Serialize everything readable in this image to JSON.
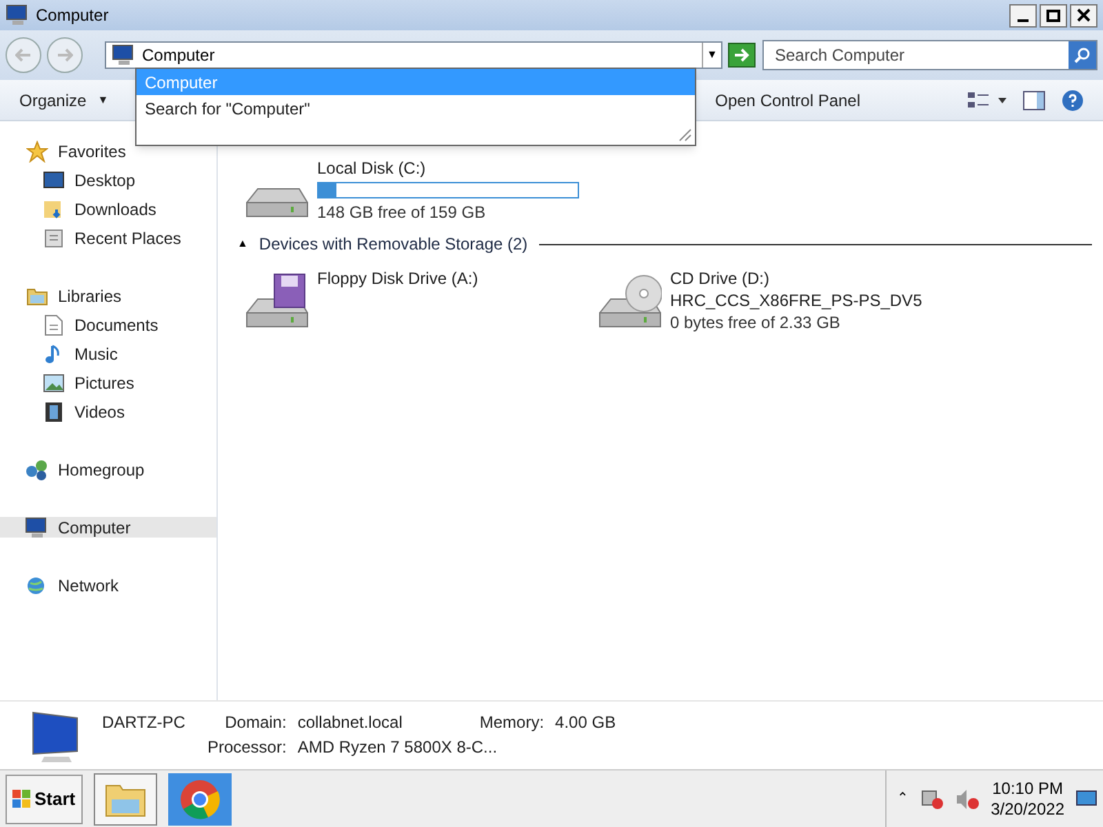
{
  "window": {
    "title": "Computer"
  },
  "address_bar": {
    "value": "Computer",
    "dropdown_arrow": "▼",
    "search_placeholder": "Search Computer"
  },
  "address_dropdown": [
    {
      "label": "Computer",
      "selected": true
    },
    {
      "label": "Search for \"Computer\"",
      "selected": false
    }
  ],
  "toolbar": {
    "left": "Organize",
    "left_caret": "▼",
    "right": "Open Control Panel"
  },
  "sidebar": [
    {
      "label": "Favorites",
      "kind": "star",
      "selected": false,
      "children": [
        {
          "label": "Desktop",
          "kind": "desktop",
          "selected": false
        },
        {
          "label": "Downloads",
          "kind": "downloads",
          "selected": false
        },
        {
          "label": "Recent Places",
          "kind": "recent",
          "selected": false
        }
      ]
    },
    {
      "label": "Libraries",
      "kind": "libraries",
      "selected": false,
      "children": [
        {
          "label": "Documents",
          "kind": "documents",
          "selected": false
        },
        {
          "label": "Music",
          "kind": "music",
          "selected": false
        },
        {
          "label": "Pictures",
          "kind": "pictures",
          "selected": false
        },
        {
          "label": "Videos",
          "kind": "videos",
          "selected": false
        }
      ]
    },
    {
      "label": "Homegroup",
      "kind": "homegroup",
      "selected": false
    },
    {
      "label": "Computer",
      "kind": "computer",
      "selected": true
    },
    {
      "label": "Network",
      "kind": "network",
      "selected": false
    }
  ],
  "hard_disk_drives": [
    {
      "kind": "disk",
      "name": "Local Disk (C:)",
      "level": 0.07,
      "free": "148 GB free of 159 GB"
    }
  ],
  "removable_storage": {
    "toggle": "▲",
    "title": "Devices with Removable Storage (2)",
    "items": [
      {
        "kind": "floppy",
        "name": "Floppy Disk Drive (A:)"
      },
      {
        "kind": "cd",
        "name": "CD Drive (D:)",
        "label": "HRC_CCS_X86FRE_PS-PS_DV5",
        "free": "0 bytes free of 2.33 GB"
      }
    ]
  },
  "details": {
    "computer_name": "DARTZ-PC",
    "fields": [
      {
        "label": "Domain:",
        "value": "collabnet.local"
      },
      {
        "label": "Memory:",
        "value": "4.00 GB"
      },
      {
        "label": "Processor:",
        "value": "AMD Ryzen 7 5800X 8-C..."
      }
    ]
  },
  "taskbar": {
    "start": "Start",
    "buttons": [
      {
        "kind": "explorer",
        "selected": true
      },
      {
        "kind": "chrome",
        "selected": false
      }
    ],
    "tray_toggle": "⌃",
    "time": "10:10 PM",
    "date": "3/20/2022"
  }
}
